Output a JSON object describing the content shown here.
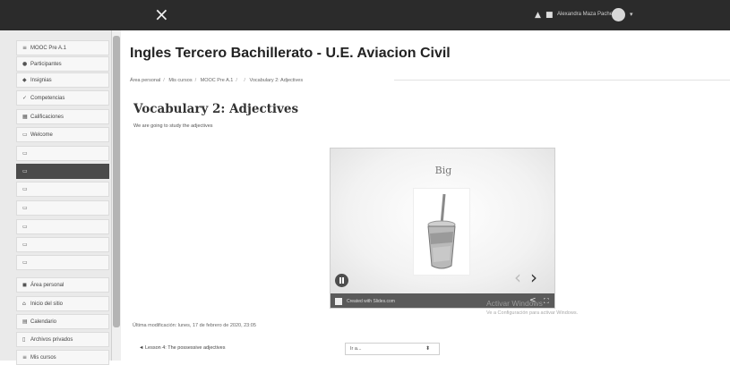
{
  "topbar": {
    "close_glyph": "×",
    "bell_glyph": "▲",
    "chat_glyph": "■",
    "user_name": "Alexandra Maza Pacheco",
    "caret_glyph": "▾"
  },
  "drawer": {
    "items": [
      {
        "icon": "graduation-cap-icon",
        "glyph": "≡",
        "label": "MOOC Pre A.1"
      },
      {
        "icon": "users-icon",
        "glyph": "●",
        "label": "Participantes"
      },
      {
        "icon": "badge-icon",
        "glyph": "◆",
        "label": "Insignias"
      },
      {
        "icon": "check-icon",
        "glyph": "✓",
        "label": "Competencias"
      },
      {
        "icon": "grid-icon",
        "glyph": "▦",
        "label": "Calificaciones"
      },
      {
        "icon": "folder-icon",
        "glyph": "▭",
        "label": "Welcome"
      },
      {
        "icon": "folder-icon",
        "glyph": "▭",
        "label": ""
      },
      {
        "icon": "folder-icon",
        "glyph": "▭",
        "label": "",
        "active": true
      },
      {
        "icon": "folder-icon",
        "glyph": "▭",
        "label": ""
      },
      {
        "icon": "folder-icon",
        "glyph": "▭",
        "label": ""
      },
      {
        "icon": "folder-icon",
        "glyph": "▭",
        "label": ""
      },
      {
        "icon": "folder-icon",
        "glyph": "▭",
        "label": ""
      },
      {
        "icon": "folder-icon",
        "glyph": "▭",
        "label": ""
      },
      {
        "icon": "dashboard-icon",
        "glyph": "◼",
        "label": "Área personal"
      },
      {
        "icon": "home-icon",
        "glyph": "⌂",
        "label": "Inicio del sitio"
      },
      {
        "icon": "calendar-icon",
        "glyph": "▤",
        "label": "Calendario"
      },
      {
        "icon": "file-icon",
        "glyph": "▯",
        "label": "Archivos privados"
      },
      {
        "icon": "graduation-cap-icon",
        "glyph": "≡",
        "label": "Mis cursos"
      }
    ]
  },
  "main": {
    "course_title": "Ingles Tercero Bachillerato - U.E. Aviacion Civil",
    "breadcrumb": [
      "Área personal",
      "Mis cursos",
      "MOOC Pre A.1",
      "",
      "Vocabulary 2: Adjectives"
    ],
    "page_title": "Vocabulary 2: Adjectives",
    "intro": "We are going to study the adjectives",
    "embed": {
      "slide_title": "Big",
      "prev_glyph": "‹",
      "next_glyph": "›",
      "made_with": "Created with Slides.com",
      "share_glyph": "<",
      "fullscreen_glyph": "⛶"
    },
    "modified": "Última modificación: lunes, 17 de febrero de 2020, 23:05",
    "prev_link": "◄ Lesson 4: The possessive adjectives",
    "jump_select": "Ir a...",
    "jump_chevron": "⬍"
  },
  "watermark": {
    "title": "Activar Windows",
    "subtitle": "Ve a Configuración para activar Windows."
  }
}
